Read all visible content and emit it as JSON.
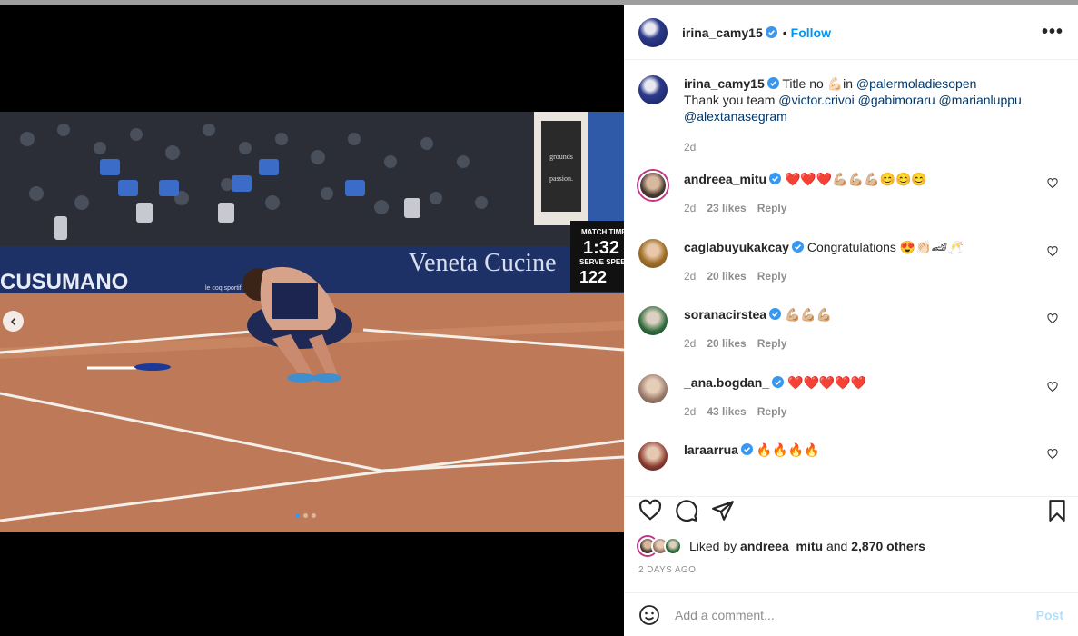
{
  "post": {
    "author": "irina_camy15",
    "follow_label": "Follow",
    "separator": "•",
    "more_label": "•••",
    "caption": {
      "username": "irina_camy15",
      "text_1": "Title no ",
      "emoji": "💪🏻",
      "text_2": "in ",
      "mention_1": "@palermoladiesopen",
      "line2_prefix": "Thank you team ",
      "mention_2": "@victor.crivoi",
      "mention_3": "@gabimoraru",
      "mention_4": "@marianluppu",
      "mention_5": "@alextanasegram",
      "time": "2d"
    }
  },
  "photo": {
    "sponsor_1": "CUSUMANO",
    "sponsor_2": "Veneta Cucine",
    "scoreboard_title": "MATCH TIME",
    "scoreboard_time": "1:32",
    "scoreboard_label": "SERVE SPEED",
    "scoreboard_speed": "122",
    "brand_tag": "le coq sportif",
    "banner_text_1": "grounds",
    "banner_text_2": "passion.",
    "slide_count": 3,
    "active_slide": 1
  },
  "comments": [
    {
      "username": "andreea_mitu",
      "text": "❤️❤️❤️💪🏼💪🏼💪🏼😊😊😊",
      "time": "2d",
      "likes": "23 likes",
      "reply": "Reply"
    },
    {
      "username": "caglabuyukakcay",
      "text": "Congratulations 😍👏🏻🏎🥂",
      "time": "2d",
      "likes": "20 likes",
      "reply": "Reply"
    },
    {
      "username": "soranacirstea",
      "text": "💪🏼💪🏼💪🏼",
      "time": "2d",
      "likes": "20 likes",
      "reply": "Reply"
    },
    {
      "username": "_ana.bogdan_",
      "text": "❤️❤️❤️❤️❤️",
      "time": "2d",
      "likes": "43 likes",
      "reply": "Reply"
    },
    {
      "username": "laraarrua",
      "text": "🔥🔥🔥🔥",
      "time": "",
      "likes": "",
      "reply": ""
    }
  ],
  "likes": {
    "prefix": "Liked by",
    "user": "andreea_mitu",
    "middle": "and",
    "others": "2,870 others"
  },
  "time_ago": "2 DAYS AGO",
  "add_comment": {
    "placeholder": "Add a comment...",
    "post_label": "Post"
  },
  "colors": {
    "link": "#00376b",
    "follow": "#0095f6",
    "verified": "#3897f0",
    "muted": "#8e8e8e",
    "post_disabled": "#b2dffc"
  }
}
